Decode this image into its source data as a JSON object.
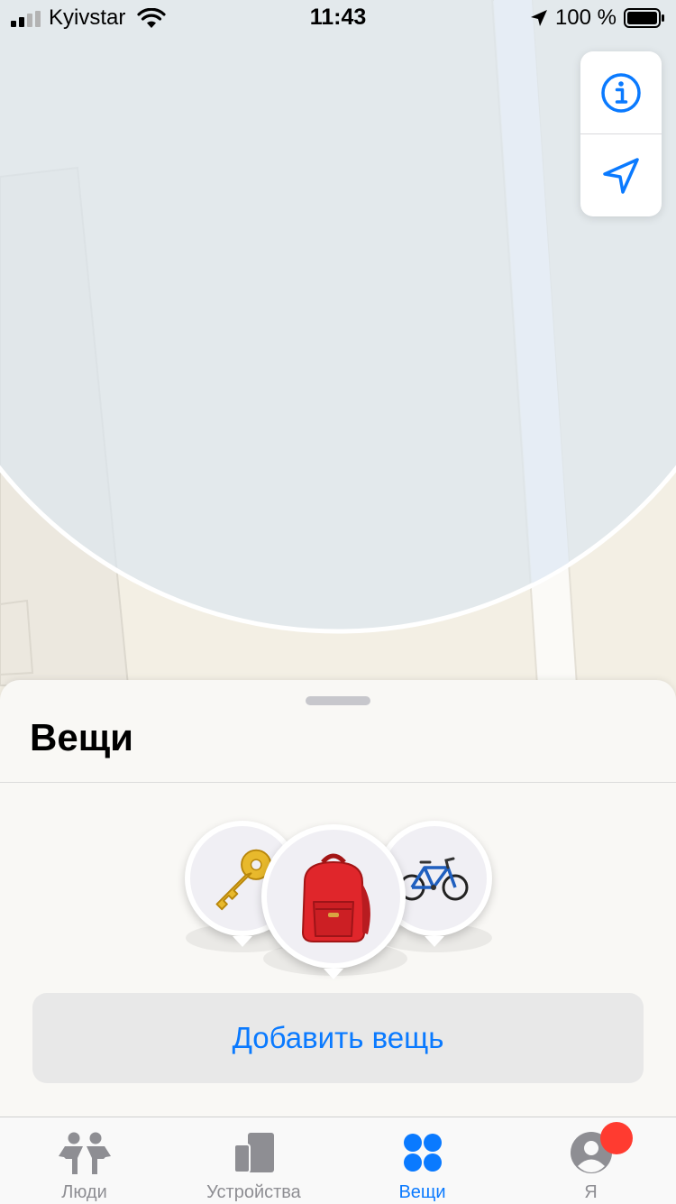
{
  "status_bar": {
    "carrier": "Kyivstar",
    "time": "11:43",
    "battery": "100 %"
  },
  "map": {
    "controls": [
      {
        "name": "info-icon"
      },
      {
        "name": "location-arrow-icon"
      }
    ]
  },
  "sheet": {
    "title": "Вещи",
    "items": [
      {
        "name": "key-item",
        "icon": "key-icon"
      },
      {
        "name": "backpack-item",
        "icon": "backpack-icon"
      },
      {
        "name": "bicycle-item",
        "icon": "bicycle-icon"
      }
    ],
    "add_button": "Добавить вещь"
  },
  "tabbar": {
    "tabs": [
      {
        "label": "Люди",
        "icon": "people-icon"
      },
      {
        "label": "Устройства",
        "icon": "devices-icon"
      },
      {
        "label": "Вещи",
        "icon": "items-icon",
        "active": true
      },
      {
        "label": "Я",
        "icon": "me-icon"
      }
    ]
  },
  "colors": {
    "accent": "#0a7aff",
    "badge": "#ff3b30"
  }
}
